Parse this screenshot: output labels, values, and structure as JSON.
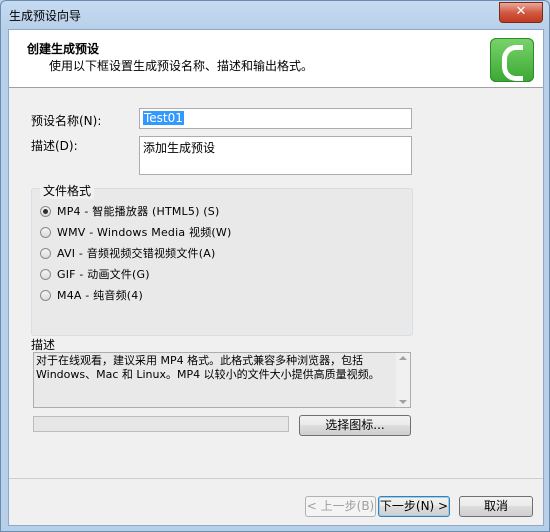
{
  "window": {
    "title": "生成预设向导",
    "close_label": "✕"
  },
  "header": {
    "title": "创建生成预设",
    "subtitle": "使用以下框设置生成预设名称、描述和输出格式。",
    "logo_icon": "camtasia-c-icon"
  },
  "form": {
    "name_label": "预设名称(N):",
    "name_value": "Test01",
    "desc_label": "描述(D):",
    "desc_value": "添加生成预设"
  },
  "formats": {
    "group_title": "文件格式",
    "options": [
      {
        "label": "MP4 - 智能播放器 (HTML5) (S)",
        "selected": true
      },
      {
        "label": "WMV - Windows Media 视频(W)",
        "selected": false
      },
      {
        "label": "AVI - 音频视频交错视频文件(A)",
        "selected": false
      },
      {
        "label": "GIF - 动画文件(G)",
        "selected": false
      },
      {
        "label": "M4A - 纯音频(4)",
        "selected": false
      }
    ]
  },
  "description": {
    "title": "描述",
    "text": "对于在线观看，建议采用 MP4 格式。此格式兼容多种浏览器，包括 Windows、Mac 和 Linux。MP4 以较小的文件大小提供高质量视频。"
  },
  "buttons": {
    "choose_icon": "选择图标...",
    "back": "< 上一步(B)",
    "next": "下一步(N) >",
    "cancel": "取消"
  },
  "colors": {
    "accent_green": "#3aa832",
    "selection_blue": "#3399ff"
  }
}
